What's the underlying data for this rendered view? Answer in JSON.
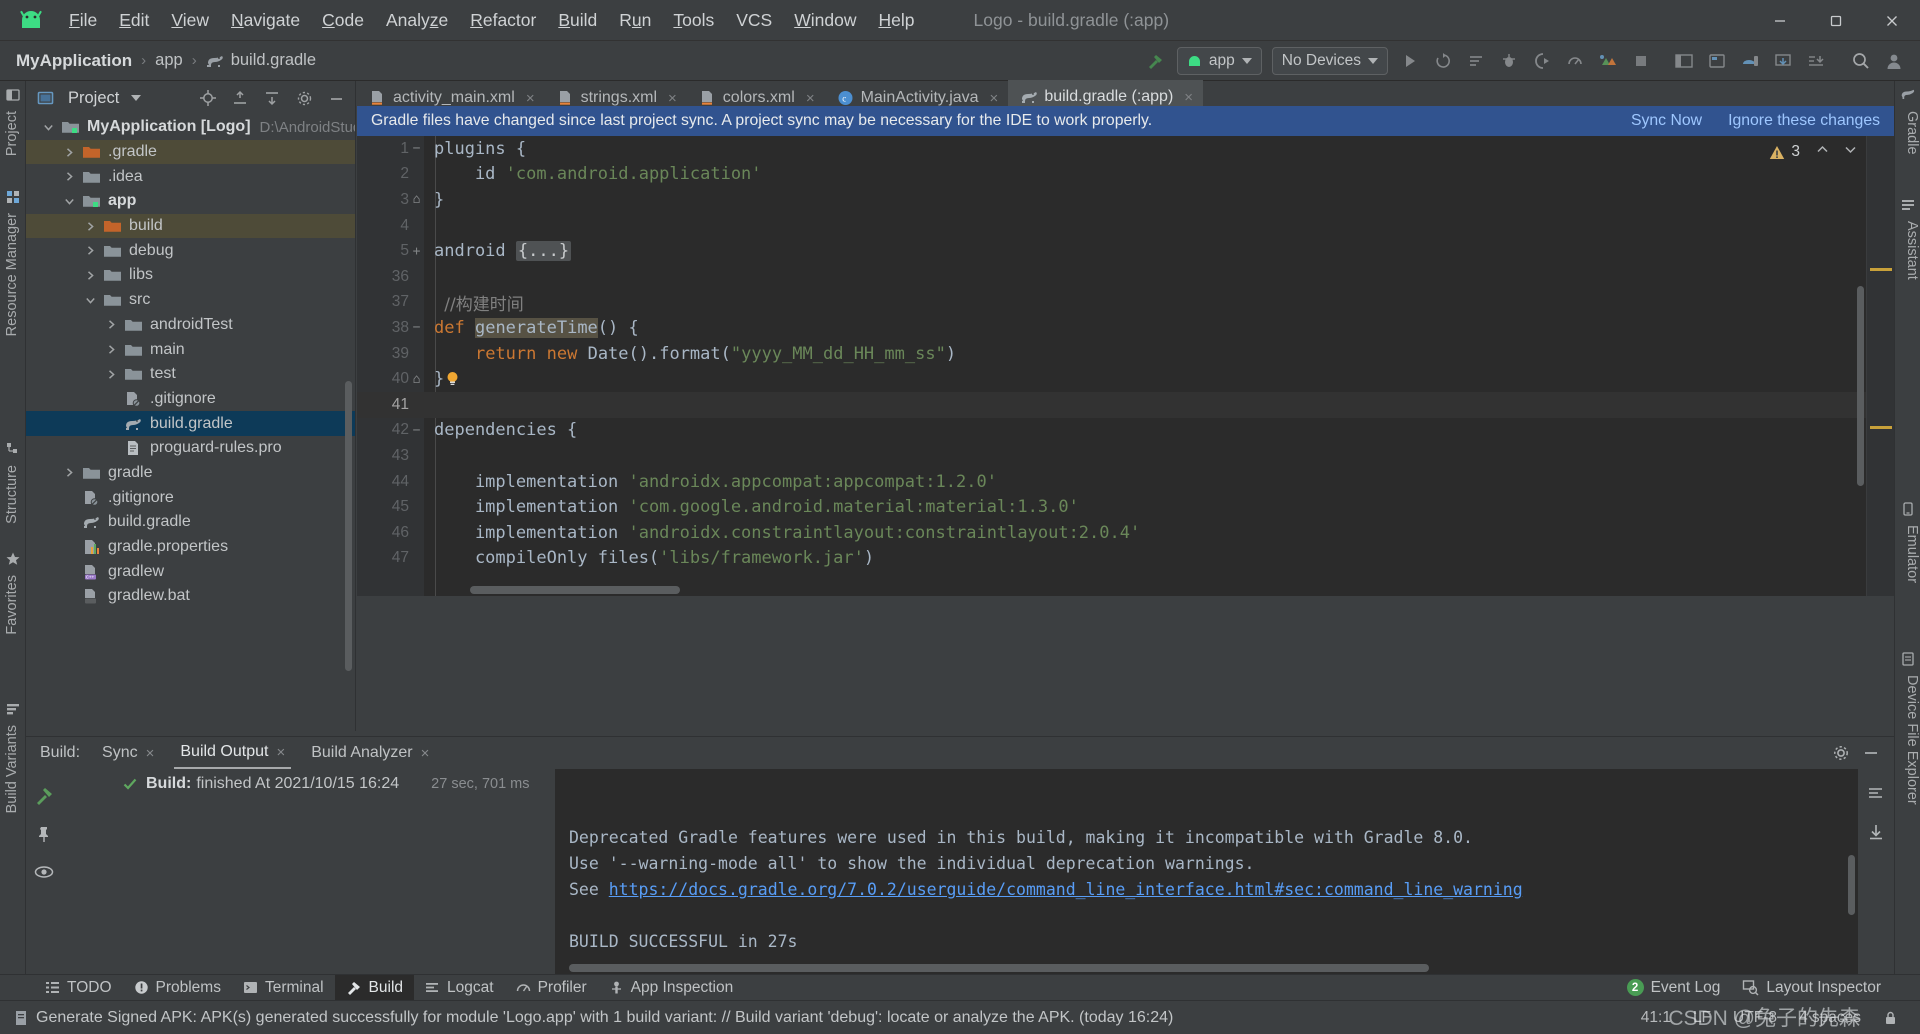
{
  "window": {
    "title": "Logo - build.gradle (:app)",
    "minimize": "—",
    "maximize": "▢",
    "close": "✕"
  },
  "menu": {
    "logo_icon": "android-robot-icon",
    "items": [
      {
        "pre": "",
        "u": "F",
        "post": "ile"
      },
      {
        "pre": "",
        "u": "E",
        "post": "dit"
      },
      {
        "pre": "",
        "u": "V",
        "post": "iew"
      },
      {
        "pre": "",
        "u": "N",
        "post": "avigate"
      },
      {
        "pre": "",
        "u": "C",
        "post": "ode"
      },
      {
        "pre": "Analy",
        "u": "z",
        "post": "e"
      },
      {
        "pre": "",
        "u": "R",
        "post": "efactor"
      },
      {
        "pre": "",
        "u": "B",
        "post": "uild"
      },
      {
        "pre": "R",
        "u": "u",
        "post": "n"
      },
      {
        "pre": "",
        "u": "T",
        "post": "ools"
      },
      {
        "pre": "VCS",
        "u": "",
        "post": ""
      },
      {
        "pre": "",
        "u": "W",
        "post": "indow"
      },
      {
        "pre": "",
        "u": "H",
        "post": "elp"
      }
    ]
  },
  "navbar": {
    "breadcrumb": {
      "project": "MyApplication",
      "module": "app",
      "file": "build.gradle",
      "separator": "›"
    },
    "run_config": "app",
    "device": "No Devices",
    "icons": [
      "hammer-build-icon",
      "run-icon",
      "apply-changes-icon",
      "apply-code-changes-icon",
      "debug-icon",
      "run-with-coverage-icon",
      "profile-icon",
      "avd-manager-icon",
      "sdk-manager-icon",
      "stop-icon",
      "project-structure-icon",
      "layout-editor-icon",
      "device-manager-icon",
      "sync-gradle-icon",
      "search-icon",
      "account-icon"
    ]
  },
  "project_panel": {
    "title": "Project",
    "header_icons": [
      "locate-icon",
      "expand-all-icon",
      "collapse-all-icon",
      "settings-gear-icon",
      "hide-panel-icon"
    ],
    "tree": [
      {
        "depth": 0,
        "arrow": "down",
        "icon": "module-folder-icon",
        "label": "MyApplication [Logo]",
        "bold": true,
        "path": "D:\\AndroidStud",
        "state": "normal"
      },
      {
        "depth": 1,
        "arrow": "right",
        "icon": "excluded-folder-icon",
        "label": ".gradle",
        "state": "brown"
      },
      {
        "depth": 1,
        "arrow": "right",
        "icon": "folder-icon",
        "label": ".idea",
        "state": "normal"
      },
      {
        "depth": 1,
        "arrow": "down",
        "icon": "module-folder-icon",
        "label": "app",
        "bold": true,
        "state": "normal"
      },
      {
        "depth": 2,
        "arrow": "right",
        "icon": "excluded-folder-icon",
        "label": "build",
        "state": "brown"
      },
      {
        "depth": 2,
        "arrow": "right",
        "icon": "folder-icon",
        "label": "debug",
        "state": "normal"
      },
      {
        "depth": 2,
        "arrow": "right",
        "icon": "folder-icon",
        "label": "libs",
        "state": "normal"
      },
      {
        "depth": 2,
        "arrow": "down",
        "icon": "folder-icon",
        "label": "src",
        "state": "normal"
      },
      {
        "depth": 3,
        "arrow": "right",
        "icon": "folder-icon",
        "label": "androidTest",
        "state": "normal"
      },
      {
        "depth": 3,
        "arrow": "right",
        "icon": "folder-icon",
        "label": "main",
        "state": "normal"
      },
      {
        "depth": 3,
        "arrow": "right",
        "icon": "folder-icon",
        "label": "test",
        "state": "normal"
      },
      {
        "depth": 3,
        "arrow": "none",
        "icon": "gitignore-file-icon",
        "label": ".gitignore",
        "state": "normal"
      },
      {
        "depth": 3,
        "arrow": "none",
        "icon": "gradle-file-icon",
        "label": "build.gradle",
        "state": "selected"
      },
      {
        "depth": 3,
        "arrow": "none",
        "icon": "text-file-icon",
        "label": "proguard-rules.pro",
        "state": "normal"
      },
      {
        "depth": 1,
        "arrow": "right",
        "icon": "folder-icon",
        "label": "gradle",
        "state": "normal"
      },
      {
        "depth": 1,
        "arrow": "none",
        "icon": "gitignore-file-icon",
        "label": ".gitignore",
        "state": "normal"
      },
      {
        "depth": 1,
        "arrow": "none",
        "icon": "gradle-file-icon",
        "label": "build.gradle",
        "state": "normal"
      },
      {
        "depth": 1,
        "arrow": "none",
        "icon": "properties-file-icon",
        "label": "gradle.properties",
        "state": "normal"
      },
      {
        "depth": 1,
        "arrow": "none",
        "icon": "shell-file-icon",
        "label": "gradlew",
        "state": "normal"
      },
      {
        "depth": 1,
        "arrow": "none",
        "icon": "bat-file-icon",
        "label": "gradlew.bat",
        "state": "normal"
      }
    ]
  },
  "editor_tabs": [
    {
      "icon": "xml-layout-icon",
      "label": "activity_main.xml",
      "active": false
    },
    {
      "icon": "xml-values-icon",
      "label": "strings.xml",
      "active": false
    },
    {
      "icon": "xml-values-icon",
      "label": "colors.xml",
      "active": false
    },
    {
      "icon": "java-class-icon",
      "label": "MainActivity.java",
      "active": false
    },
    {
      "icon": "gradle-file-icon",
      "label": "build.gradle (:app)",
      "active": true
    }
  ],
  "banner": {
    "message": "Gradle files have changed since last project sync. A project sync may be necessary for the IDE to work properly.",
    "sync_now": "Sync Now",
    "ignore": "Ignore these changes"
  },
  "editor": {
    "warnings_count": "3",
    "warning_icon": "warning-triangle-icon",
    "up_arrow": "⌃",
    "down_arrow": "⌄",
    "lines": [
      {
        "num": "1",
        "fold": "−",
        "html": "plugins {",
        "current": false
      },
      {
        "num": "2",
        "fold": "",
        "html": "    id <span class='str'>'com.android.application'</span>",
        "current": false
      },
      {
        "num": "3",
        "fold": "⌂",
        "html": "}",
        "current": false
      },
      {
        "num": "4",
        "fold": "",
        "html": "",
        "current": false
      },
      {
        "num": "5",
        "fold": "+",
        "html": "android <span class='fold-ph'>{...}</span>",
        "current": false
      },
      {
        "num": "36",
        "fold": "",
        "html": "",
        "current": false
      },
      {
        "num": "37",
        "fold": "",
        "html": " <span class='com'>//构建时间</span>",
        "current": false
      },
      {
        "num": "38",
        "fold": "−",
        "html": "<span class='kw'>def</span> <span class='hlident'>generateTime</span>() {",
        "current": false
      },
      {
        "num": "39",
        "fold": "",
        "html": "    <span class='kw'>return</span> <span class='kw'>new</span> Date().format(<span class='str'>\"yyyy_MM_dd_HH_mm_ss\"</span>)",
        "current": false
      },
      {
        "num": "40",
        "fold": "⌂",
        "html": "}",
        "current": false,
        "bulb": true
      },
      {
        "num": "41",
        "fold": "",
        "html": "",
        "current": true
      },
      {
        "num": "42",
        "fold": "−",
        "html": "dependencies {",
        "current": false
      },
      {
        "num": "43",
        "fold": "",
        "html": "",
        "current": false
      },
      {
        "num": "44",
        "fold": "",
        "html": "    implementation <span class='str'>'androidx.appcompat:appcompat:1.2.0'</span>",
        "current": false
      },
      {
        "num": "45",
        "fold": "",
        "html": "    implementation <span class='str'>'com.google.android.material:material:1.3.0'</span>",
        "current": false
      },
      {
        "num": "46",
        "fold": "",
        "html": "    implementation <span class='str'>'androidx.constraintlayout:constraintlayout:2.0.4'</span>",
        "current": false
      },
      {
        "num": "47",
        "fold": "",
        "html": "    compileOnly files(<span class='str'>'libs/framework.jar'</span>)",
        "current": false
      }
    ]
  },
  "build_panel": {
    "label": "Build:",
    "tabs": [
      {
        "label": "Sync",
        "active": false,
        "close": "×"
      },
      {
        "label": "Build Output",
        "active": true,
        "close": "×"
      },
      {
        "label": "Build Analyzer",
        "active": false,
        "close": "×"
      }
    ],
    "settings_icon": "settings-gear-icon",
    "minimize_icon": "minimize-icon",
    "rail_icons": [
      "build-hammer-icon",
      "pin-icon",
      "eye-icon"
    ],
    "tree_item": {
      "status_icon": "check-green-icon",
      "bold": "Build:",
      "text": "finished At 2021/10/15 16:24",
      "duration": "27 sec, 701 ms"
    },
    "console_lines": [
      {
        "text": "",
        "type": "faint"
      },
      {
        "text": "",
        "type": "plain"
      },
      {
        "text": "Deprecated Gradle features were used in this build, making it incompatible with Gradle 8.0.",
        "type": "plain"
      },
      {
        "text": "Use '--warning-mode all' to show the individual deprecation warnings.",
        "type": "plain"
      },
      {
        "text": "See ",
        "type": "link",
        "link": "https://docs.gradle.org/7.0.2/userguide/command_line_interface.html#sec:command_line_warning"
      },
      {
        "text": "",
        "type": "plain"
      },
      {
        "text": "BUILD SUCCESSFUL in 27s",
        "type": "plain"
      }
    ],
    "console_side_icons": [
      "rerun-icon",
      "filter-icon",
      "download-icon"
    ]
  },
  "bottom_tabs": [
    {
      "icon": "todo-icon",
      "label": "TODO",
      "active": false
    },
    {
      "icon": "problems-icon",
      "label": "Problems",
      "active": false
    },
    {
      "icon": "terminal-icon",
      "label": "Terminal",
      "active": false
    },
    {
      "icon": "build-hammer-icon",
      "label": "Build",
      "active": true
    },
    {
      "icon": "logcat-icon",
      "label": "Logcat",
      "active": false
    },
    {
      "icon": "profiler-icon",
      "label": "Profiler",
      "active": false
    },
    {
      "icon": "app-inspection-icon",
      "label": "App Inspection",
      "active": false
    }
  ],
  "bottom_right": {
    "event_log_count": "2",
    "event_log": "Event Log",
    "layout_inspector_icon": "layout-inspector-icon",
    "layout_inspector": "Layout Inspector"
  },
  "status_bar": {
    "message": "Generate Signed APK: APK(s) generated successfully for module 'Logo.app' with 1 build variant: // Build variant 'debug': locate or analyze the APK. (today 16:24)",
    "caret": "41:1",
    "line_sep": "LF",
    "encoding": "UTF-8",
    "indent": "4 spaces",
    "lock_icon": "lock-icon",
    "watermark": "CSDN @兔子的先森"
  },
  "left_rail": [
    {
      "label": "Project",
      "icon": "project-icon"
    },
    {
      "label": "Resource Manager",
      "icon": "resource-icon"
    },
    {
      "label": "Structure",
      "icon": "structure-icon"
    },
    {
      "label": "Favorites",
      "icon": "star-icon"
    },
    {
      "label": "Build Variants",
      "icon": "variants-icon"
    }
  ],
  "right_rail": [
    {
      "label": "Gradle",
      "icon": "gradle-icon"
    },
    {
      "label": "Assistant",
      "icon": "assistant-icon"
    },
    {
      "label": "Emulator",
      "icon": "emulator-icon"
    },
    {
      "label": "Device File Explorer",
      "icon": "device-file-icon"
    }
  ],
  "colors": {
    "chrome": "#3c3f41",
    "editor_bg": "#2b2b2b",
    "banner_blue": "#31538f",
    "accent_green": "#3ddc84",
    "selection_blue": "#0d3a58",
    "excluded_brown": "#4e4b38",
    "link_blue": "#589df6",
    "string_green": "#6a8759",
    "keyword_orange": "#cc7832"
  }
}
